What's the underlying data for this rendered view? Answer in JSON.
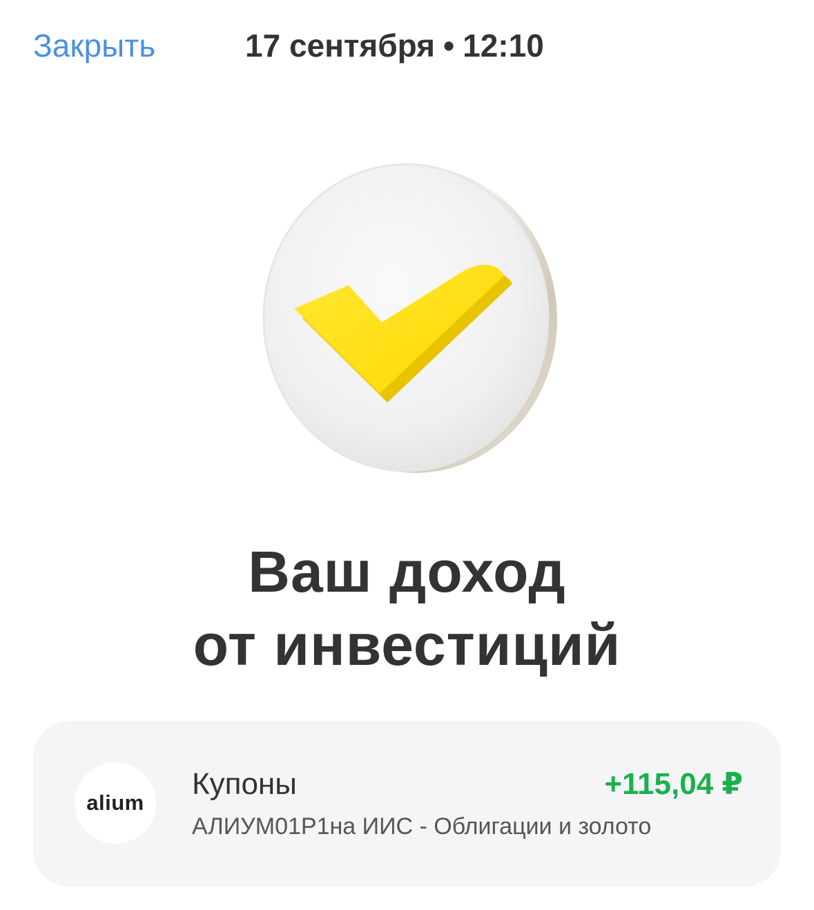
{
  "header": {
    "close_label": "Закрыть",
    "date": "17 сентября",
    "separator": "•",
    "time": "12:10"
  },
  "hero": {
    "icon": "checkmark-coin-icon",
    "accent_color": "#ffe000"
  },
  "title": {
    "line1": "Ваш доход",
    "line2": "от инвестиций"
  },
  "income_card": {
    "logo_text": "alium",
    "type": "Купоны",
    "amount": "+115,04 ₽",
    "amount_color": "#1bb14c",
    "description": "АЛИУМ01Р1на ИИС - Облигации и золото"
  }
}
